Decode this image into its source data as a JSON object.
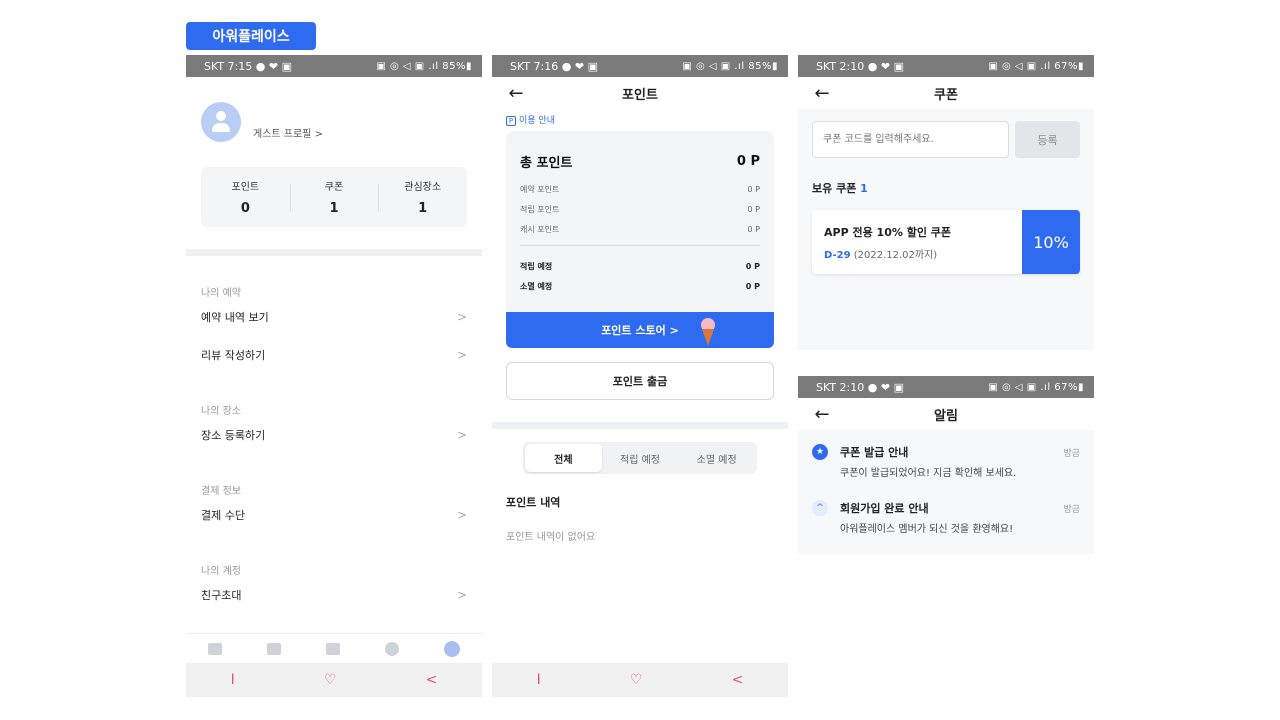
{
  "brand_badge": "아워플레이스",
  "screen1": {
    "status": {
      "left": "SKT 7:15 ● ❤ ▣",
      "right": "▣ ◎ ◁ ▣ .ıl 85%▮"
    },
    "profile_name": "게스트 프로필",
    "stats": [
      {
        "label": "포인트",
        "value": "0"
      },
      {
        "label": "쿠폰",
        "value": "1"
      },
      {
        "label": "관심장소",
        "value": "1"
      }
    ],
    "sections": [
      {
        "title": "나의 예약",
        "items": [
          "예약 내역 보기",
          "리뷰 작성하기"
        ]
      },
      {
        "title": "나의 장소",
        "items": [
          "장소 등록하기"
        ]
      },
      {
        "title": "결제 정보",
        "items": [
          "결제 수단"
        ]
      },
      {
        "title": "나의 계정",
        "items": [
          "친구초대"
        ]
      }
    ],
    "tab_icons": [
      "home-icon",
      "play-icon",
      "document-icon",
      "chat-icon",
      "profile-icon"
    ],
    "nav": {
      "left": "I",
      "center": "♡",
      "right": "<"
    }
  },
  "screen2": {
    "status": {
      "left": "SKT 7:16 ● ❤ ▣",
      "right": "▣ ◎ ◁ ▣ .ıl 85%▮"
    },
    "title": "포인트",
    "guide": "이용 안내",
    "guide_icon": "P",
    "total_label": "총 포인트",
    "total_value": "0 P",
    "rows": [
      {
        "label": "예약 포인트",
        "value": "0 P"
      },
      {
        "label": "적립 포인트",
        "value": "0 P"
      },
      {
        "label": "캐시 포인트",
        "value": "0 P"
      }
    ],
    "strong_rows": [
      {
        "label": "적립 예정",
        "value": "0 P"
      },
      {
        "label": "소멸 예정",
        "value": "0 P"
      }
    ],
    "store_btn": "포인트 스토어 >",
    "withdraw_btn": "포인트 출금",
    "tabs": [
      "전체",
      "적립 예정",
      "소멸 예정"
    ],
    "history_title": "포인트 내역",
    "history_empty": "포인트 내역이 없어요",
    "nav": {
      "left": "I",
      "center": "♡",
      "right": "<"
    }
  },
  "screen3": {
    "status": {
      "left": "SKT 2:10 ● ❤ ▣",
      "right": "▣ ◎ ◁ ▣ .ıl 67%▮"
    },
    "title": "쿠폰",
    "code_placeholder": "쿠폰 코드를 입력해주세요.",
    "register_btn": "등록",
    "owned_label": "보유 쿠폰",
    "owned_count": "1",
    "coupon_name": "APP 전용 10% 할인 쿠폰",
    "coupon_dday": "D-29",
    "coupon_date": " (2022.12.02까지)",
    "coupon_rate": "10%"
  },
  "screen4": {
    "status": {
      "left": "SKT 2:10 ● ❤ ▣",
      "right": "▣ ◎ ◁ ▣ .ıl 67%▮"
    },
    "title": "알림",
    "notifications": [
      {
        "icon": "★",
        "title": "쿠폰 발급 안내",
        "desc": "쿠폰이 발급되었어요! 지금 확인해 보세요.",
        "time": "방금"
      },
      {
        "icon": "^",
        "title": "회원가입 완료 안내",
        "desc": "아워플레이스 멤버가 되신 것을 환영해요!",
        "time": "방금"
      }
    ]
  },
  "colors": {
    "accent": "#2f6bf0",
    "status_bar": "#7a7a7a",
    "nav_pink": "#e0517e"
  }
}
